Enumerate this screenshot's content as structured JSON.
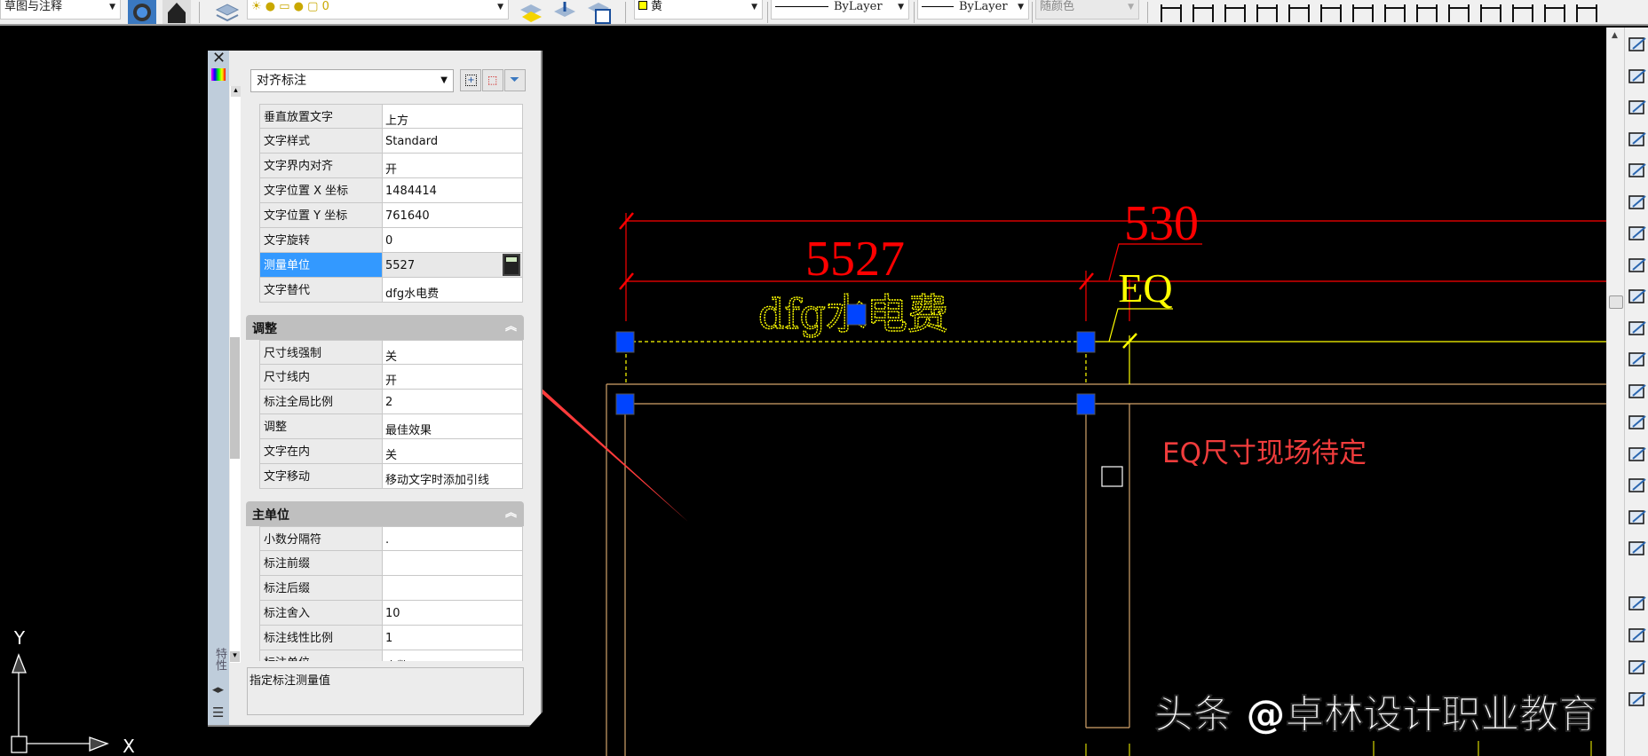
{
  "toolbar": {
    "workspace_value": "草图与注释",
    "color_value": "黄",
    "color_swatch": "#ffff00",
    "linetype_value": "ByLayer",
    "lineweight_value": "ByLayer",
    "plotstyle_value": "随颜色",
    "icons": [
      "gear-icon",
      "home-icon",
      "layers-icon",
      "layer-match-icon",
      "layer-previous-icon",
      "layer-states-icon",
      "linear-dim-icon",
      "aligned-dim-icon",
      "arc-length-icon",
      "ordinate-icon",
      "radius-icon",
      "jogged-icon",
      "diameter-icon",
      "angular-icon",
      "quick-dim-icon",
      "baseline-icon",
      "continue-icon",
      "dim-space-icon",
      "dim-break-icon",
      "tolerance-icon"
    ]
  },
  "panel": {
    "side_label": "特性",
    "object_type": "对齐标注",
    "general_rows": [
      {
        "label": "垂直放置文字",
        "value": "上方"
      },
      {
        "label": "文字样式",
        "value": "Standard"
      },
      {
        "label": "文字界内对齐",
        "value": "开"
      },
      {
        "label": "文字位置 X 坐标",
        "value": "1484414"
      },
      {
        "label": "文字位置 Y 坐标",
        "value": "761640"
      },
      {
        "label": "文字旋转",
        "value": "0"
      },
      {
        "label": "测量单位",
        "value": "5527",
        "selected": true
      },
      {
        "label": "文字替代",
        "value": "dfg水电费"
      }
    ],
    "fit_section": {
      "title": "调整",
      "rows": [
        {
          "label": "尺寸线强制",
          "value": "关"
        },
        {
          "label": "尺寸线内",
          "value": "开"
        },
        {
          "label": "标注全局比例",
          "value": "2"
        },
        {
          "label": "调整",
          "value": "最佳效果"
        },
        {
          "label": "文字在内",
          "value": "关"
        },
        {
          "label": "文字移动",
          "value": "移动文字时添加引线"
        }
      ]
    },
    "primary_units_section": {
      "title": "主单位",
      "rows": [
        {
          "label": "小数分隔符",
          "value": "."
        },
        {
          "label": "标注前缀",
          "value": ""
        },
        {
          "label": "标注后缀",
          "value": ""
        },
        {
          "label": "标注舍入",
          "value": "10"
        },
        {
          "label": "标注线性比例",
          "value": "1"
        },
        {
          "label": "标注单位",
          "value": "小数"
        }
      ]
    },
    "description": "指定标注测量值"
  },
  "drawing": {
    "dim_main": "5527",
    "dim_secondary": "530",
    "eq_text": "EQ",
    "text_override": "dfg水电费",
    "note": "EQ尺寸现场待定",
    "watermark": "头条 @卓林设计职业教育",
    "ucs_x": "X",
    "ucs_y": "Y",
    "colors": {
      "dimension": "#ff0000",
      "selected_dim": "#ffff00",
      "wall": "#d2a36a",
      "grip": "#0044ff",
      "note": "#f03c3c",
      "annotation_arrow": "#ff3b3b"
    }
  }
}
